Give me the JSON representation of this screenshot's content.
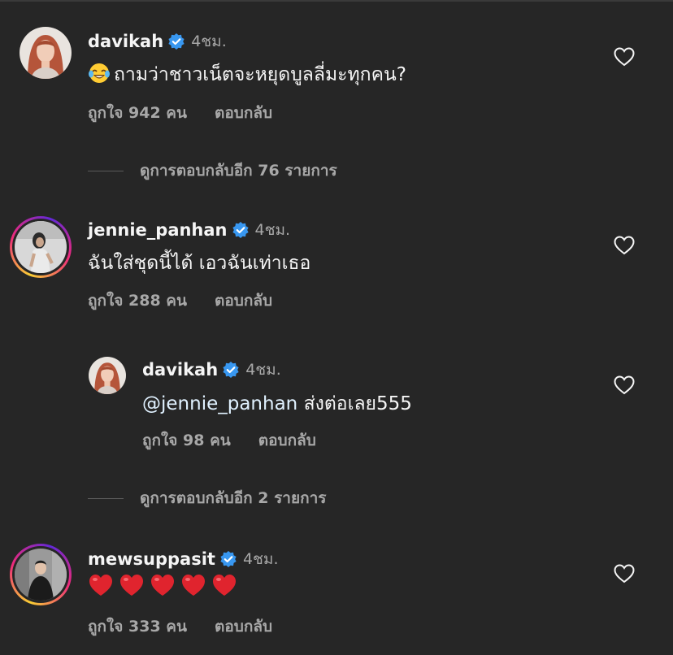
{
  "comments": [
    {
      "username": "davikah",
      "time": "4ชม.",
      "text": "ถามว่าชาวเน็ตจะหยุดบูลลี่มะทุกคน?",
      "emoji": "laughing-tears-emoji",
      "likes": "ถูกใจ 942 คน",
      "reply": "ตอบกลับ"
    },
    {
      "username": "jennie_panhan",
      "time": "4ชม.",
      "text": "ฉันใส่ชุดนี้ได้ เอวฉันเท่าเธอ",
      "likes": "ถูกใจ 288 คน",
      "reply": "ตอบกลับ"
    },
    {
      "username": "davikah",
      "time": "4ชม.",
      "mention": "@jennie_panhan",
      "text": " ส่งต่อเลย555",
      "likes": "ถูกใจ 98 คน",
      "reply": "ตอบกลับ"
    },
    {
      "username": "mewsuppasit",
      "time": "4ชม.",
      "emoji": "red-heart-emoji x5",
      "likes": "ถูกใจ 333 คน",
      "reply": "ตอบกลับ"
    }
  ],
  "view_replies": [
    "ดูการตอบกลับอีก 76 รายการ",
    "ดูการตอบกลับอีก 2 รายการ"
  ],
  "colors": {
    "background": "#262626",
    "verified": "#3897f0",
    "secondary_text": "#a8a8a8"
  }
}
